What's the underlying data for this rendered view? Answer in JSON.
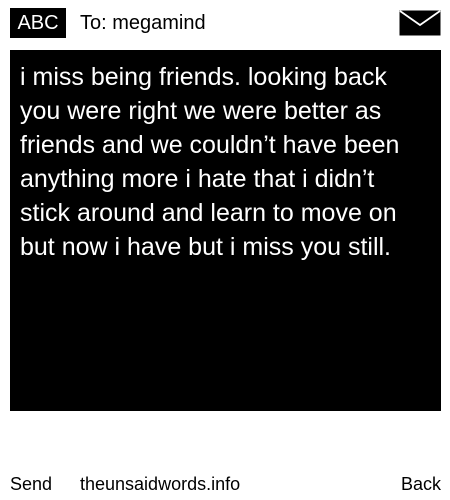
{
  "header": {
    "mode_label": "ABC",
    "recipient": "To: megamind",
    "envelope_icon": "envelope-icon"
  },
  "message": {
    "lines": [
      "i miss being friends. looking back",
      "you were right we were better as",
      "friends and we couldn’t have been",
      "anything more i hate that i didn’t",
      "stick around and learn to move on",
      "but now i have but i miss you still."
    ]
  },
  "footer": {
    "send_label": "Send",
    "site": "theunsaidwords.info",
    "back_label": "Back"
  },
  "colors": {
    "background": "#ffffff",
    "message_bg": "#000000",
    "message_text": "#ffffff",
    "text": "#000000"
  }
}
